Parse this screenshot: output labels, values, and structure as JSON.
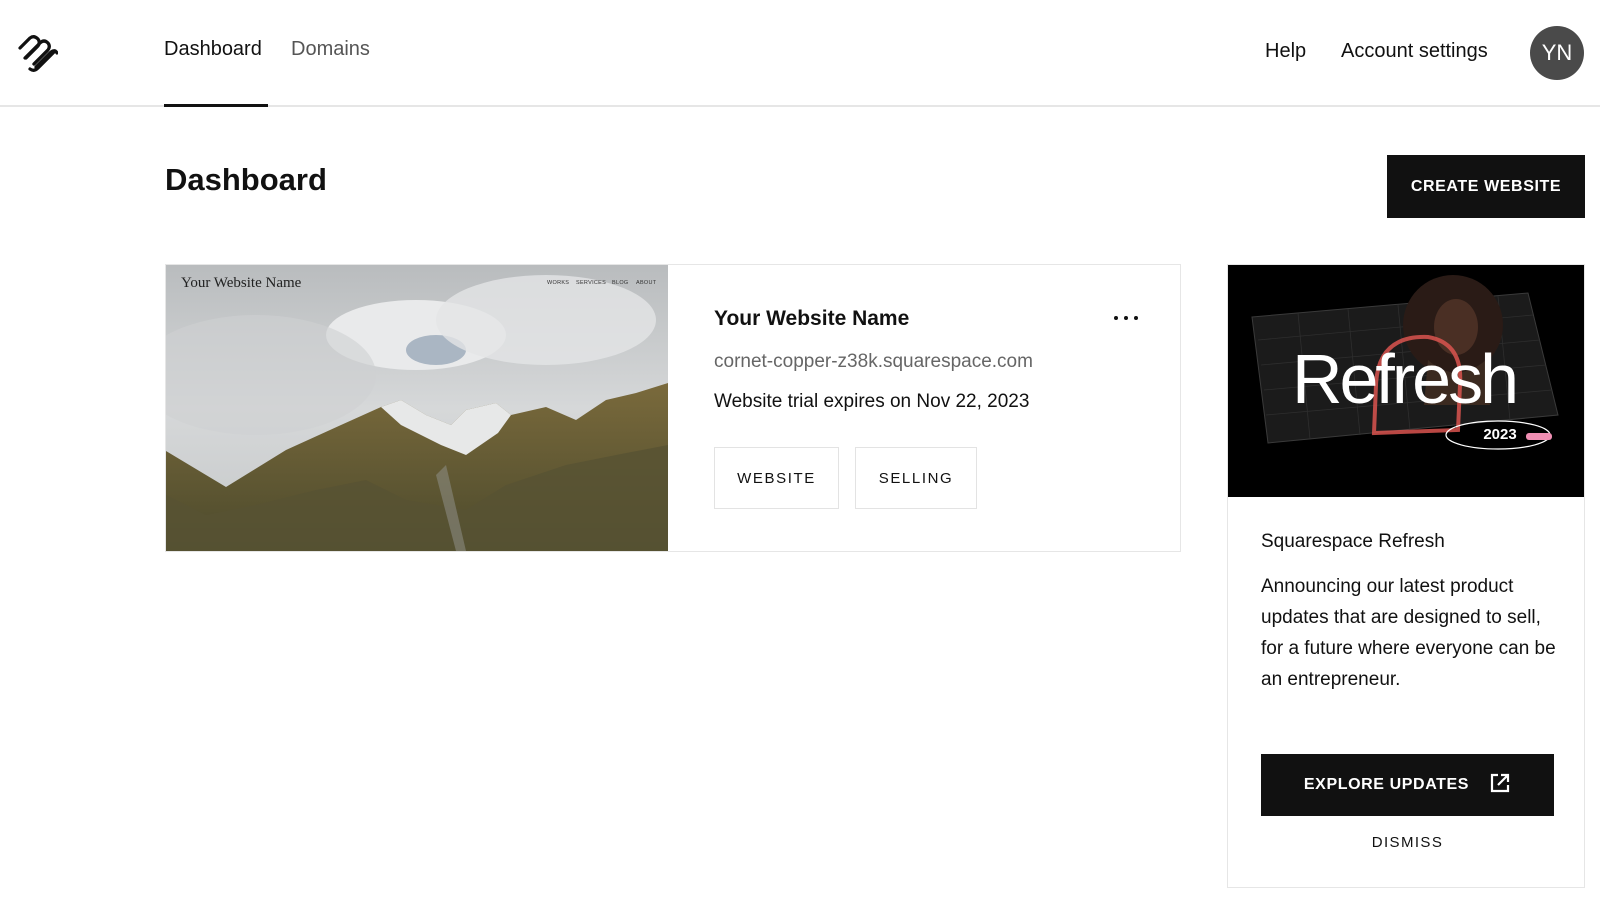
{
  "nav": {
    "tabs": [
      {
        "label": "Dashboard",
        "active": true
      },
      {
        "label": "Domains",
        "active": false
      }
    ],
    "help": "Help",
    "account_settings": "Account settings",
    "avatar_initials": "YN",
    "logo_icon": "squarespace-logo-icon"
  },
  "header": {
    "title": "Dashboard",
    "create_button": "CREATE WEBSITE"
  },
  "site": {
    "preview": {
      "title": "Your Website Name",
      "menu": [
        "WORKS",
        "SERVICES",
        "BLOG",
        "ABOUT"
      ]
    },
    "name": "Your Website Name",
    "url": "cornet-copper-z38k.squarespace.com",
    "trial": "Website trial expires on Nov 22, 2023",
    "more_icon": "more-horizontal-icon",
    "buttons": {
      "website": "WEBSITE",
      "selling": "SELLING"
    }
  },
  "promo": {
    "image_title": "Refresh",
    "image_year": "2023",
    "title": "Squarespace Refresh",
    "body": "Announcing our latest product updates that are designed to sell, for a future where everyone can be an entrepreneur.",
    "explore_button": "EXPLORE UPDATES",
    "explore_icon": "external-link-icon",
    "dismiss_button": "DISMISS"
  },
  "colors": {
    "primary": "#111111",
    "border": "#e6e6e6",
    "muted_text": "#666666",
    "avatar_bg": "#4a4a4a"
  }
}
